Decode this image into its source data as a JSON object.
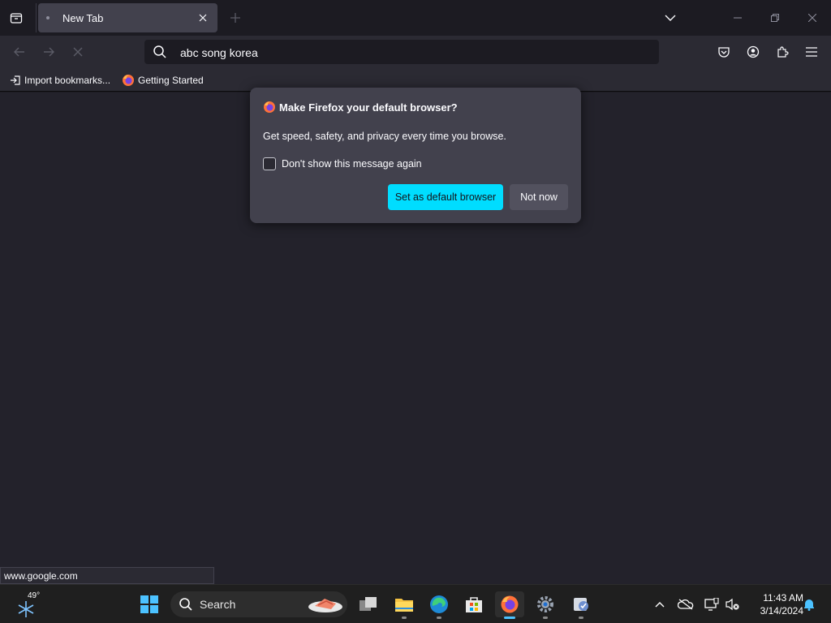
{
  "browser": {
    "tab": {
      "title": "New Tab"
    },
    "url_text": "abc song korea",
    "bookmarks": [
      {
        "label": "Import bookmarks..."
      },
      {
        "label": "Getting Started"
      }
    ],
    "status_url": "www.google.com"
  },
  "popup": {
    "title": "Make Firefox your default browser?",
    "body": "Get speed, safety, and privacy every time you browse.",
    "checkbox_label": "Don't show this message again",
    "primary_button": "Set as default browser",
    "secondary_button": "Not now"
  },
  "taskbar": {
    "weather_temp": "49°",
    "search_label": "Search",
    "time": "11:43 AM",
    "date": "3/14/2024"
  },
  "colors": {
    "accent": "#00ddff",
    "tab_bg": "#42414d",
    "toolbar_bg": "#2b2a33",
    "content_bg": "#23222b",
    "taskbar_active": "#4cc2ff"
  }
}
